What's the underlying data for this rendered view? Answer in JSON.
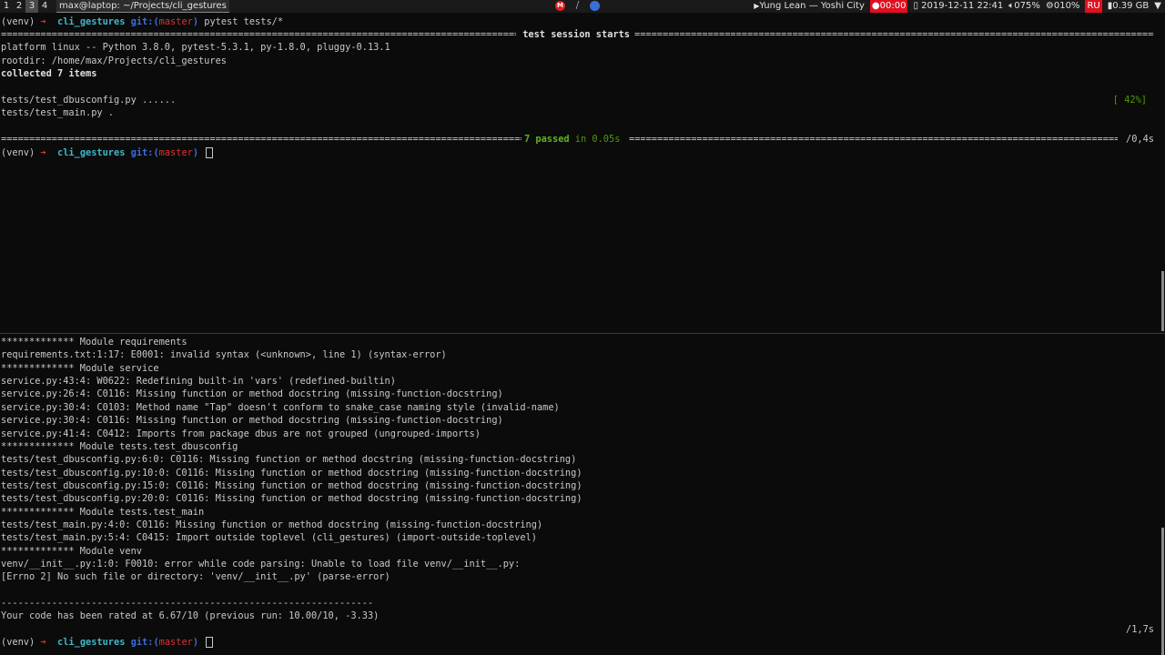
{
  "topbar": {
    "workspaces": [
      "1",
      "2",
      "3",
      "4"
    ],
    "active_workspace": "3",
    "window_title": "max@laptop: ~/Projects/cli_gestures",
    "tray_icons": [
      "mega-icon",
      "slash-icon",
      "google-icon"
    ],
    "tray_m_label": "M",
    "now_playing": "Yung Lean — Yoshi City",
    "record_timer": "00:00",
    "datetime": "2019-12-11 22:41",
    "volume": "075%",
    "cpu": "010%",
    "lang": "RU",
    "memory": "0.39 GB"
  },
  "prompt": {
    "venv": "(venv)",
    "arrow": "➜",
    "dir": "cli_gestures",
    "git": "git:",
    "branch": "master",
    "open": "(",
    "close": ")"
  },
  "pane1": {
    "command": "pytest tests/*",
    "header_title": " test session starts ",
    "platform": "platform linux -- Python 3.8.0, pytest-5.3.1, py-1.8.0, pluggy-0.13.1",
    "rootdir": "rootdir: /home/max/Projects/cli_gestures",
    "collected": "collected 7 items",
    "test1": "tests/test_dbusconfig.py ......",
    "test1_pct": "[ 42%]",
    "test2": "tests/test_main.py .",
    "summary_passed": "7 passed",
    "summary_time": " in 0.05s ",
    "elapsed": "/0,4s"
  },
  "pane2": {
    "lines": [
      "************* Module requirements",
      "requirements.txt:1:17: E0001: invalid syntax (<unknown>, line 1) (syntax-error)",
      "************* Module service",
      "service.py:43:4: W0622: Redefining built-in 'vars' (redefined-builtin)",
      "service.py:26:4: C0116: Missing function or method docstring (missing-function-docstring)",
      "service.py:30:4: C0103: Method name \"Tap\" doesn't conform to snake_case naming style (invalid-name)",
      "service.py:30:4: C0116: Missing function or method docstring (missing-function-docstring)",
      "service.py:41:4: C0412: Imports from package dbus are not grouped (ungrouped-imports)",
      "************* Module tests.test_dbusconfig",
      "tests/test_dbusconfig.py:6:0: C0116: Missing function or method docstring (missing-function-docstring)",
      "tests/test_dbusconfig.py:10:0: C0116: Missing function or method docstring (missing-function-docstring)",
      "tests/test_dbusconfig.py:15:0: C0116: Missing function or method docstring (missing-function-docstring)",
      "tests/test_dbusconfig.py:20:0: C0116: Missing function or method docstring (missing-function-docstring)",
      "************* Module tests.test_main",
      "tests/test_main.py:4:0: C0116: Missing function or method docstring (missing-function-docstring)",
      "tests/test_main.py:5:4: C0415: Import outside toplevel (cli_gestures) (import-outside-toplevel)",
      "************* Module venv",
      "venv/__init__.py:1:0: F0010: error while code parsing: Unable to load file venv/__init__.py:",
      "[Errno 2] No such file or directory: 'venv/__init__.py' (parse-error)",
      "",
      "------------------------------------------------------------------",
      "Your code has been rated at 6.67/10 (previous run: 10.00/10, -3.33)"
    ],
    "elapsed": "/1,7s"
  },
  "colors": {
    "background": "#0b0b0b",
    "prompt_arrow": "#dd3333",
    "prompt_dir": "#3fb8c8",
    "prompt_git": "#3b6fd8",
    "passed_green": "#4e9a06"
  }
}
